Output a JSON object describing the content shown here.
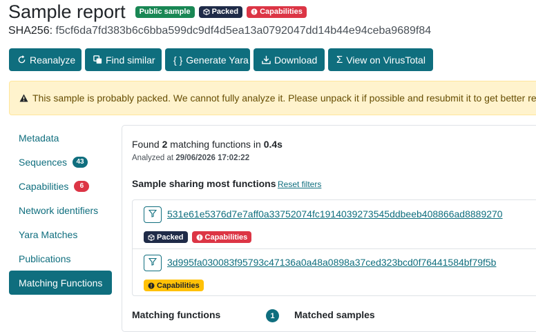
{
  "header": {
    "title": "Sample report",
    "badges": {
      "public": "Public sample",
      "packed": "Packed",
      "capabilities": "Capabilities"
    },
    "hash_label": "SHA256:",
    "hash_value": "f5cf6da7fd383b6c6bba599dc9df4d5ea13a0792047dd14b44e94ceba9689f84"
  },
  "toolbar": {
    "reanalyze": "Reanalyze",
    "find_similar": "Find similar",
    "generate_yara": "Generate Yara",
    "download": "Download",
    "virustotal": "View on VirusTotal"
  },
  "alert": {
    "text": "This sample is probably packed. We cannot fully analyze it. Please unpack it if possible and resubmit it to get better results."
  },
  "sidebar": {
    "items": [
      {
        "label": "Metadata"
      },
      {
        "label": "Sequences",
        "count": "43"
      },
      {
        "label": "Capabilities",
        "count": "6"
      },
      {
        "label": "Network identifiers"
      },
      {
        "label": "Yara Matches"
      },
      {
        "label": "Publications"
      },
      {
        "label": "Matching Functions"
      }
    ]
  },
  "main": {
    "found_prefix": "Found",
    "found_count": "2",
    "found_middle": "matching functions in",
    "found_time": "0.4s",
    "analyzed_prefix": "Analyzed at",
    "analyzed_at": "29/06/2026 17:02:22",
    "section_title": "Sample sharing most functions",
    "reset_filters": "Reset filters",
    "samples": [
      {
        "hash": "531e61e5376d7e7aff0a33752074fc1914039273545ddbeeb408866ad8889270",
        "badge_packed": "Packed",
        "badge_capabilities": "Capabilities"
      },
      {
        "hash": "3d995fa030083f95793c47136a0a48a0898a37ced323bcd0f76441584bf79f5b",
        "badge_capabilities": "Capabilities"
      }
    ],
    "matching_functions_label": "Matching functions",
    "matching_functions_count": "1",
    "matched_samples_label": "Matched samples"
  },
  "colors": {
    "accent": "#0f6e7e",
    "success": "#198754",
    "danger": "#dc3545",
    "dark": "#1f2b48",
    "warning": "#ffc107",
    "alert_bg": "#fff3cd"
  }
}
